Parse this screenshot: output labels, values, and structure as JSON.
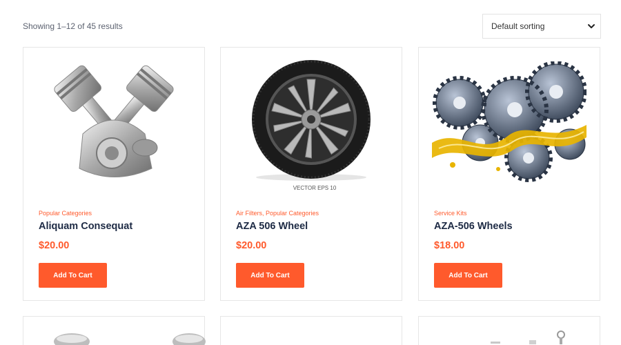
{
  "toolbar": {
    "result_count": "Showing 1–12 of 45 results",
    "sort": {
      "selected": "Default sorting",
      "icon": "chevron-down-icon"
    }
  },
  "products": [
    {
      "categories": "Popular Categories",
      "title": "Aliquam Consequat",
      "price": "$20.00",
      "button": "Add To Cart",
      "image": "engine-pistons-image"
    },
    {
      "categories": "Air Filters, Popular Categories",
      "title": "AZA 506 Wheel",
      "price": "$20.00",
      "button": "Add To Cart",
      "image": "wheel-tire-image",
      "image_caption": "VECTOR EPS 10"
    },
    {
      "categories": "Service Kits",
      "title": "AZA-506 Wheels",
      "price": "$18.00",
      "button": "Add To Cart",
      "image": "gears-oil-image"
    }
  ],
  "colors": {
    "accent": "#ff5a2c",
    "title": "#1d2a44",
    "border": "#e6e6e6"
  }
}
